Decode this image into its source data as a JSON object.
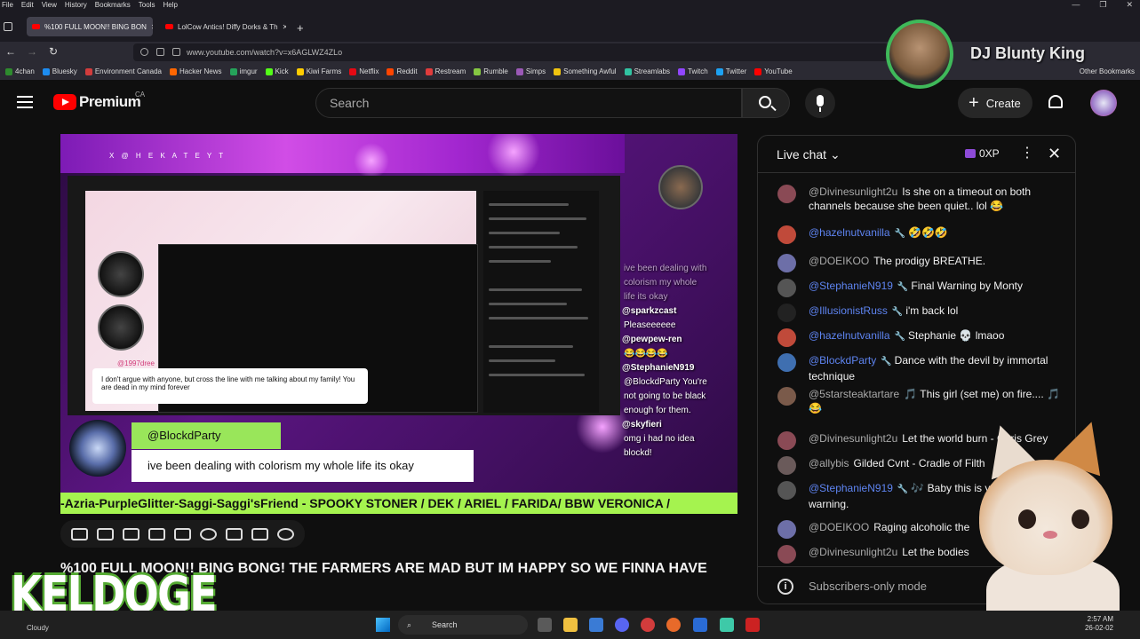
{
  "browser": {
    "menu": [
      "File",
      "Edit",
      "View",
      "History",
      "Bookmarks",
      "Tools",
      "Help"
    ],
    "tabs": [
      {
        "label": "%100 FULL MOON!! BING BON"
      },
      {
        "label": "LolCow Antics! Diffy Dorks & Th"
      }
    ],
    "url": "www.youtube.com/watch?v=x6AGLWZ4ZLo",
    "bookmarks": [
      "4chan",
      "Bluesky",
      "Environment Canada",
      "Hacker News",
      "imgur",
      "Kick",
      "Kiwi Farms",
      "Netflix",
      "Reddit",
      "Restream",
      "Rumble",
      "Simps",
      "Something Awful",
      "Streamlabs",
      "Twitch",
      "Twitter",
      "YouTube"
    ],
    "other_bookmarks": "Other Bookmarks"
  },
  "overlay": {
    "streamer_name": "DJ Blunty King",
    "corner_logo": "KELDOGE"
  },
  "youtube": {
    "logo_text": "Premium",
    "region": "CA",
    "search_placeholder": "Search",
    "create_label": "Create"
  },
  "video": {
    "banner_text": "X @ H E K A T E Y T",
    "inner_quote": "I don't argue with anyone, but cross the line with me talking about my family! You are dead in my mind forever",
    "inner_user": "@1997dree",
    "name_tag": "@BlockdParty",
    "message": "ive been dealing with colorism my whole life its okay",
    "ticker": "-Azria-PurpleGlitter-Saggi-Saggi'sFriend - SPOOKY STONER / DEK / ARIEL / FARIDA/ BBW VERONICA /",
    "title": "%100 FULL MOON!! BING BONG! THE FARMERS ARE MAD BUT IM HAPPY SO WE FINNA HAVE",
    "overlay_chat": [
      {
        "name": "",
        "text": "ive been dealing with"
      },
      {
        "name": "",
        "text": "colorism my whole"
      },
      {
        "name": "",
        "text": "life its okay"
      },
      {
        "name": "@sparkzcast",
        "text": ""
      },
      {
        "name": "",
        "text": "Pleaseeeeee"
      },
      {
        "name": "@pewpew-ren",
        "text": ""
      },
      {
        "name": "",
        "text": "😂😂😂😂"
      },
      {
        "name": "@StephanieN919",
        "text": ""
      },
      {
        "name": "",
        "text": "@BlockdParty You're"
      },
      {
        "name": "",
        "text": "not going to be black"
      },
      {
        "name": "",
        "text": "enough for them."
      },
      {
        "name": "@skyfieri",
        "text": ""
      },
      {
        "name": "",
        "text": "omg i had no idea"
      },
      {
        "name": "",
        "text": "blockd!"
      }
    ]
  },
  "chat": {
    "title": "Live chat",
    "xp": "0XP",
    "messages": [
      {
        "author": "@Divinesunlight2u",
        "mod": false,
        "text": "Is she on a timeout on both channels because she been quiet.. lol 😂",
        "color": "#8a4a55"
      },
      {
        "author": "@hazelnutvanilla",
        "mod": true,
        "text": "🤣🤣🤣",
        "color": "#c04a3a"
      },
      {
        "author": "@DOEIKOO",
        "mod": false,
        "text": "The prodigy BREATHE.",
        "color": "#6d6fa8"
      },
      {
        "author": "@StephanieN919",
        "mod": true,
        "text": "Final Warning by Monty",
        "color": "#555555"
      },
      {
        "author": "@IllusionistRuss",
        "mod": true,
        "text": "i'm back lol",
        "color": "#222222"
      },
      {
        "author": "@hazelnutvanilla",
        "mod": true,
        "text": "Stephanie 💀 lmaoo",
        "color": "#c04a3a"
      },
      {
        "author": "@BlockdParty",
        "mod": true,
        "text": "Dance with the devil by immortal technique",
        "color": "#3f6fb0"
      },
      {
        "author": "@5starsteaktartare",
        "mod": false,
        "text": "🎵 This girl (set me) on fire.... 🎵😂",
        "color": "#7a5a4a"
      },
      {
        "author": "@Divinesunlight2u",
        "mod": false,
        "text": "Let the world burn - Chris Grey",
        "color": "#8a4a55"
      },
      {
        "author": "@allybis",
        "mod": false,
        "text": "Gilded Cvnt - Cradle of Filth",
        "color": "#6a5a5a"
      },
      {
        "author": "@StephanieN919",
        "mod": true,
        "text": "🎶 Baby this is your final warning.",
        "color": "#555555"
      },
      {
        "author": "@DOEIKOO",
        "mod": false,
        "text": "Raging alcoholic the",
        "color": "#6d6fa8"
      },
      {
        "author": "@Divinesunlight2u",
        "mod": false,
        "text": "Let the bodies",
        "color": "#8a4a55"
      }
    ],
    "footer": "Subscribers-only mode"
  },
  "taskbar": {
    "weather": "Cloudy",
    "search": "Search",
    "time": "2:57 AM",
    "date": "26-02-02"
  }
}
